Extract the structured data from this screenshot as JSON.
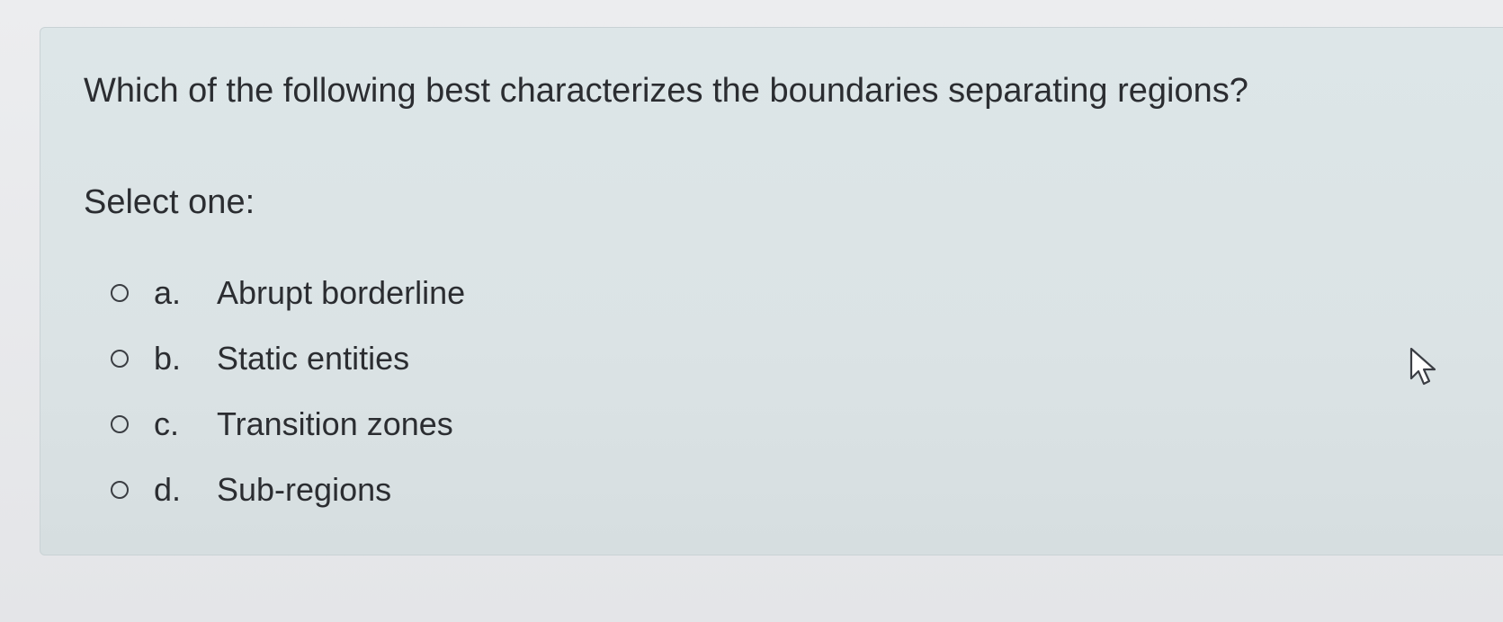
{
  "question": {
    "text": "Which of the following best characterizes the boundaries separating regions?",
    "prompt": "Select one:",
    "options": [
      {
        "letter": "a.",
        "label": "Abrupt borderline"
      },
      {
        "letter": "b.",
        "label": "Static entities"
      },
      {
        "letter": "c.",
        "label": "Transition zones"
      },
      {
        "letter": "d.",
        "label": "Sub-regions"
      }
    ]
  },
  "colors": {
    "panel_background": "#dde6e8",
    "page_background": "#ecedef",
    "text": "#2b2d31"
  },
  "icons": {
    "radio": "radio-button-empty",
    "cursor": "mouse-pointer-arrow"
  }
}
